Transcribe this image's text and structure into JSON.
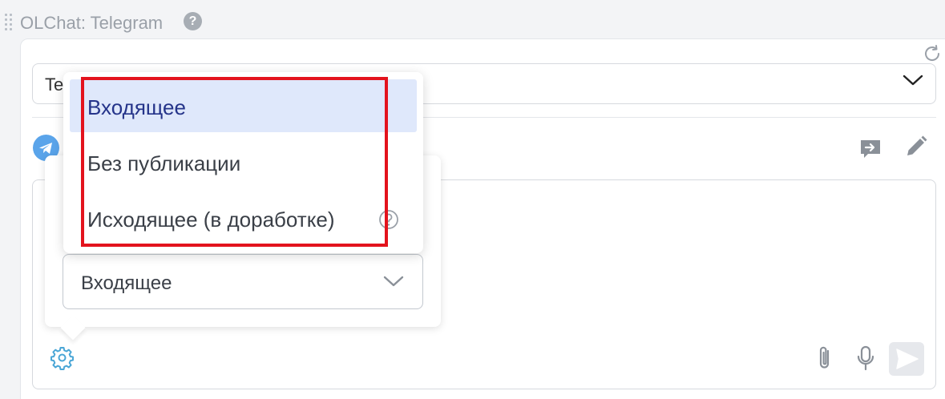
{
  "widget": {
    "title": "OLChat: Telegram",
    "help": "?"
  },
  "channel_select": {
    "value": "Te"
  },
  "message_type": {
    "selected": "Входящее",
    "options": [
      "Входящее",
      "Без публикации",
      "Исходящее (в доработке)"
    ]
  },
  "colors": {
    "accent": "#5aa4ea",
    "selected_option_bg": "#dfe8fb",
    "selected_option_text": "#25348a",
    "highlight": "#e3131d"
  },
  "icons": {
    "drag": "drag-handle-icon",
    "help": "question-icon",
    "refresh": "refresh-icon",
    "chevron": "chevron-down-icon",
    "telegram": "telegram-icon",
    "forward": "forward-message-icon",
    "edit": "pencil-icon",
    "settings": "gear-icon",
    "attach": "paperclip-icon",
    "mic": "microphone-icon",
    "send": "send-icon"
  }
}
